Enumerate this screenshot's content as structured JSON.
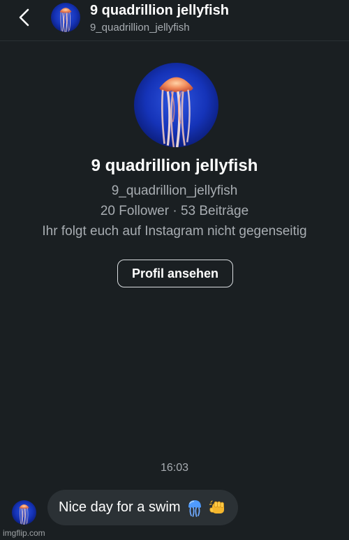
{
  "header": {
    "back_icon": "chevron-left-icon",
    "name": "9 quadrillion jellyfish",
    "handle": "9_quadrillion_jellyfish"
  },
  "profile": {
    "avatar_icon": "jellyfish-avatar",
    "name": "9 quadrillion jellyfish",
    "handle": "9_quadrillion_jellyfish",
    "stats": "20 Follower · 53 Beiträge",
    "follow_status": "Ihr folgt euch auf Instagram nicht gegenseitig",
    "view_profile_label": "Profil ansehen"
  },
  "chat": {
    "timestamp": "16:03",
    "messages": [
      {
        "text": "Nice day for a swim",
        "emojis": [
          "jellyfish-emoji",
          "fist-bump-emoji"
        ]
      }
    ]
  },
  "watermark": "imgflip.com",
  "colors": {
    "background": "#1a1f22",
    "bubble": "#2b3135",
    "secondary_text": "#a8adb2",
    "button_border": "#d9dde0"
  }
}
